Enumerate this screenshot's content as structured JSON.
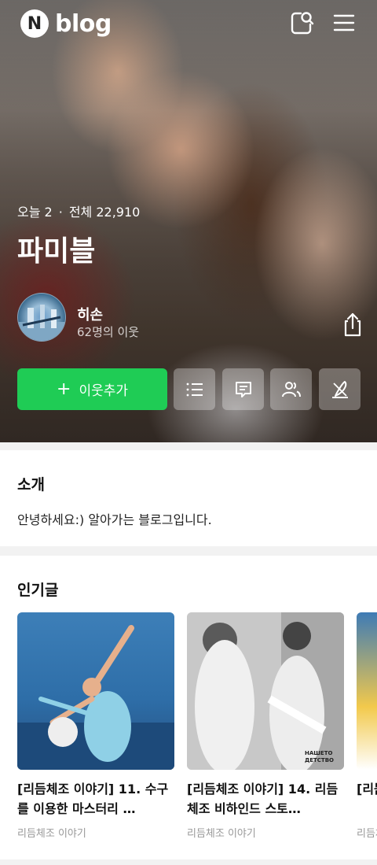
{
  "header": {
    "logo_letter": "N",
    "logo_text": "blog"
  },
  "blog": {
    "today_label": "오늘 2",
    "total_label": "전체 22,910",
    "separator": "·",
    "title": "파미블"
  },
  "owner": {
    "name": "히손",
    "neighbors": "62명의 이웃"
  },
  "actions": {
    "follow_label": "이웃추가",
    "follow_symbol": "+"
  },
  "intro": {
    "heading": "소개",
    "text": "안녕하세요:) 알아가는 블로그입니다."
  },
  "popular": {
    "heading": "인기글",
    "posts": [
      {
        "title": "[리듬체조 이야기] 11. 수구를 이용한 마스터리 …",
        "category": "리듬체조 이야기"
      },
      {
        "title": "[리듬체조 이야기] 14. 리듬체조 비하인드 스토…",
        "category": "리듬체조 이야기"
      },
      {
        "title": "[리듬체조 이야기]",
        "category": "리듬체조 이야기"
      }
    ],
    "watermark_line1": "НАШЕТО",
    "watermark_line2": "ДЕТСТВО"
  },
  "colors": {
    "accent": "#1fcc55"
  },
  "icons": [
    "search-note-icon",
    "menu-icon",
    "share-icon",
    "list-icon",
    "comment-icon",
    "neighbors-icon",
    "write-icon"
  ]
}
